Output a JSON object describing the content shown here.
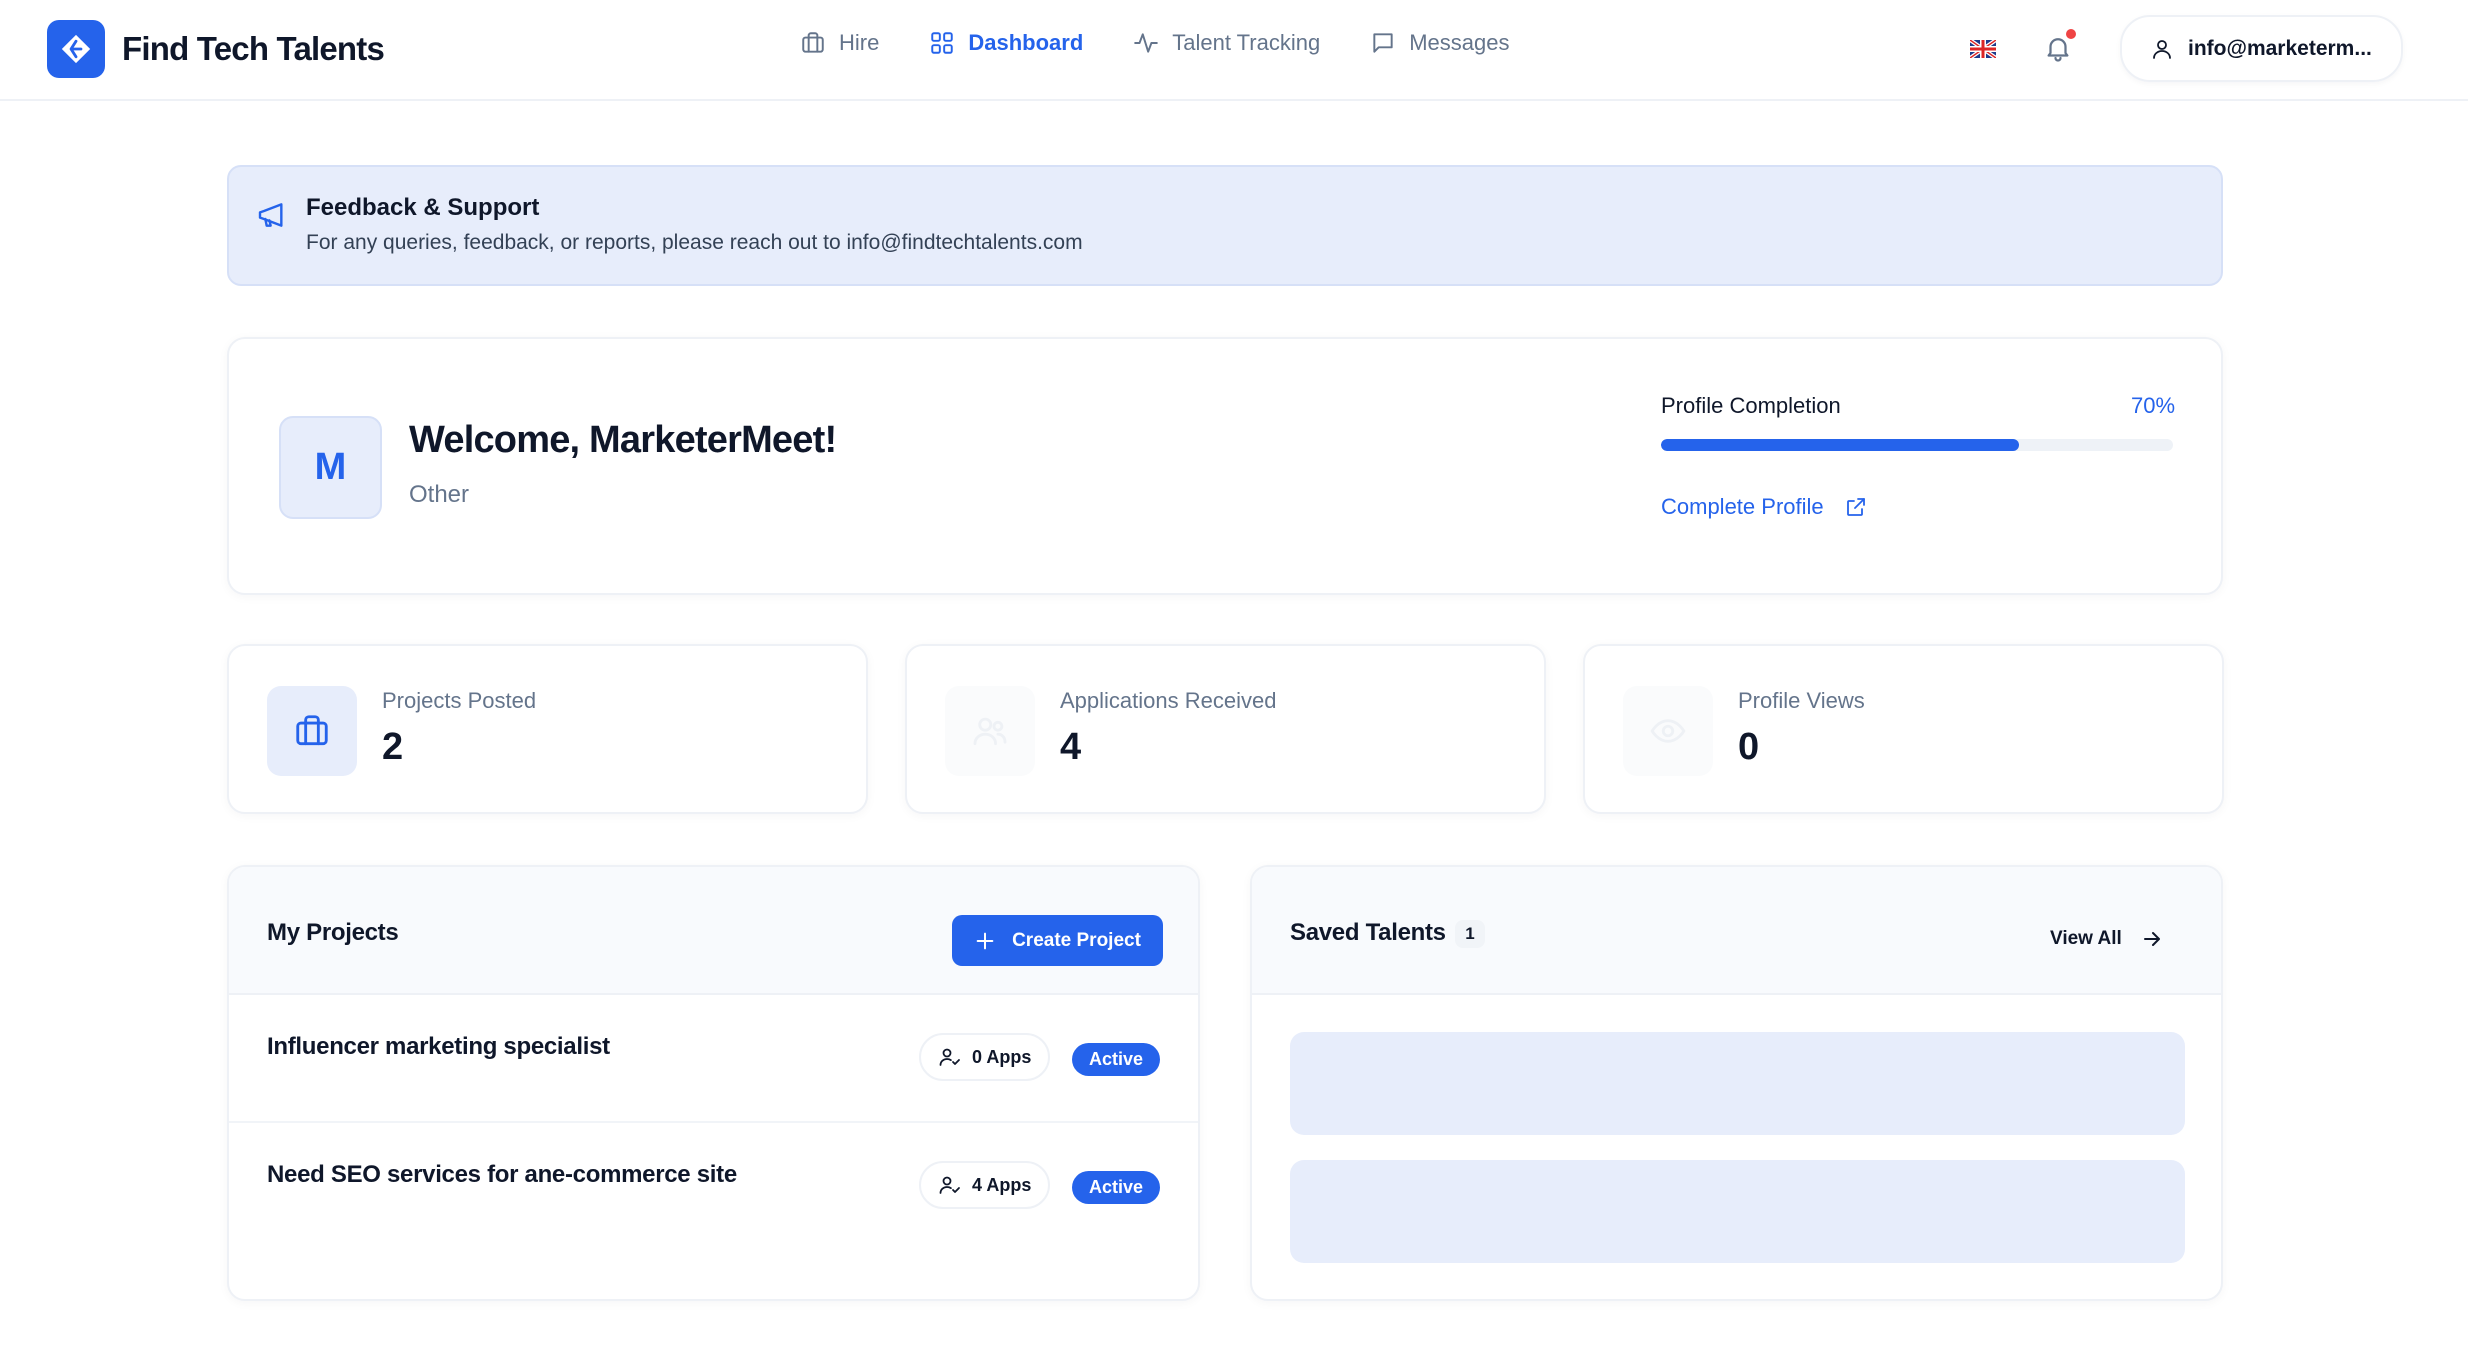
{
  "brand": {
    "name": "Find Tech Talents",
    "accent": "#2563eb"
  },
  "nav": [
    {
      "label": "Hire",
      "icon": "briefcase-icon",
      "active": false
    },
    {
      "label": "Dashboard",
      "icon": "grid-icon",
      "active": true
    },
    {
      "label": "Talent Tracking",
      "icon": "activity-icon",
      "active": false
    },
    {
      "label": "Messages",
      "icon": "message-icon",
      "active": false
    }
  ],
  "header": {
    "language_icon": "uk-flag-icon",
    "account_label": "info@marketerm..."
  },
  "banner": {
    "title": "Feedback & Support",
    "text": "For any queries, feedback, or reports, please reach out to info@findtechtalents.com"
  },
  "welcome": {
    "avatar_letter": "M",
    "title": "Welcome, MarketerMeet!",
    "subtitle": "Other",
    "profile_completion_label": "Profile Completion",
    "profile_completion_value": "70%",
    "profile_completion_fraction": 0.7,
    "complete_profile_label": "Complete Profile"
  },
  "stats": [
    {
      "label": "Projects Posted",
      "value": "2",
      "icon": "briefcase-icon"
    },
    {
      "label": "Applications Received",
      "value": "4",
      "icon": "users-icon"
    },
    {
      "label": "Profile Views",
      "value": "0",
      "icon": "eye-icon"
    }
  ],
  "projects": {
    "title": "My Projects",
    "create_label": "Create Project",
    "items": [
      {
        "name": "Influencer marketing specialist",
        "apps": "0 Apps",
        "status": "Active"
      },
      {
        "name": "Need SEO services for ane-commerce site",
        "apps": "4 Apps",
        "status": "Active"
      }
    ]
  },
  "saved_talents": {
    "title": "Saved Talents",
    "count": "1",
    "view_all_label": "View All"
  }
}
